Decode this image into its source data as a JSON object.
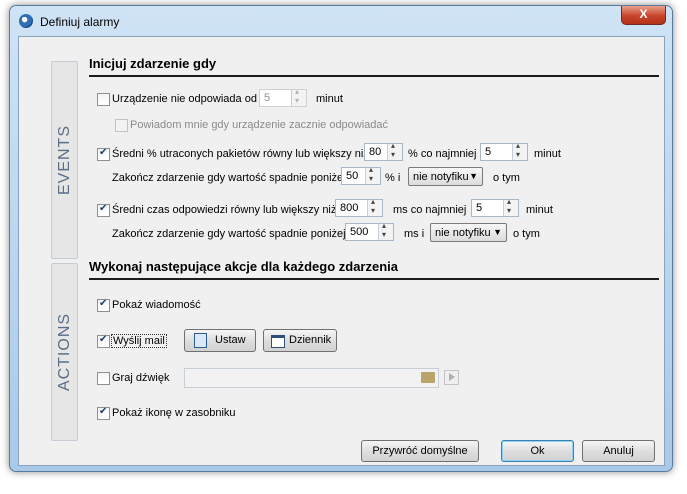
{
  "window": {
    "title": "Definiuj alarmy",
    "close_glyph": "X"
  },
  "tabs": {
    "events": "EVENTS",
    "actions": "ACTIONS"
  },
  "events": {
    "title": "Inicjuj zdarzenie gdy",
    "no_response": {
      "label": "Urządzenie nie odpowiada od",
      "value": "5",
      "unit": "minut",
      "checked": false
    },
    "notify_when_responds": {
      "label": "Powiadom mnie gdy urządzenie zacznie odpowiadać",
      "checked": false,
      "enabled": false
    },
    "packet_loss": {
      "label": "Średni % utraconych pakietów równy lub większy niż",
      "value": "80",
      "mid": "% co najmniej",
      "count": "5",
      "unit": "minut",
      "checked": true,
      "end_label": "Zakończ zdarzenie gdy wartość spadnie poniżej",
      "end_value": "50",
      "end_mid": "% i",
      "notify_option": "nie notyfiku",
      "end_suffix": "o tym"
    },
    "response_time": {
      "label": "Średni czas odpowiedzi równy lub większy niż",
      "value": "800",
      "mid": "ms co najmniej",
      "count": "5",
      "unit": "minut",
      "checked": true,
      "end_label": "Zakończ zdarzenie gdy wartość spadnie poniżej",
      "end_value": "500",
      "end_mid": "ms i",
      "notify_option": "nie notyfiku",
      "end_suffix": "o tym"
    }
  },
  "actions": {
    "title": "Wykonaj następujące akcje dla każdego zdarzenia",
    "show_message": {
      "label": "Pokaż wiadomość",
      "checked": true
    },
    "send_mail": {
      "label": "Wyślij mail",
      "checked": true,
      "setup_button": "Ustaw",
      "log_button": "Dziennik"
    },
    "play_sound": {
      "label": "Graj dźwięk",
      "checked": false,
      "path": ""
    },
    "tray_icon": {
      "label": "Pokaż ikonę w zasobniku",
      "checked": true
    }
  },
  "footer": {
    "restore_defaults": "Przywróć domyślne",
    "ok": "Ok",
    "cancel": "Anuluj"
  }
}
